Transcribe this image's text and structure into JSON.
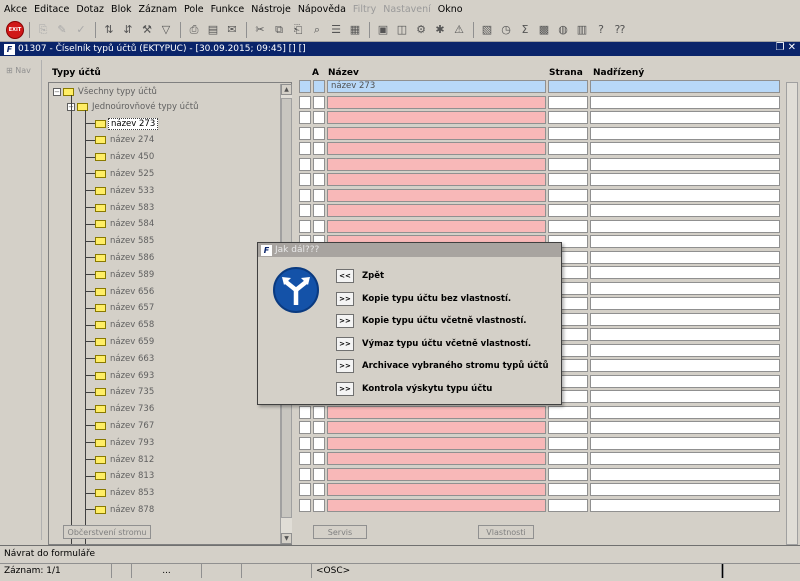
{
  "menu": [
    "Akce",
    "Editace",
    "Dotaz",
    "Blok",
    "Záznam",
    "Pole",
    "Funkce",
    "Nástroje",
    "Nápověda",
    "Filtry",
    "Nastavení",
    "Okno"
  ],
  "menu_disabled": [
    "Filtry",
    "Nastavení"
  ],
  "window": {
    "title": "01307 - Číselník typů účtů (EKTYPUC) - [30.09.2015; 09:45]  []  []",
    "controls": "❐ ✕"
  },
  "nav_label": "Nav",
  "tree": {
    "header": "Typy účtů",
    "root": "Všechny typy účtů",
    "child": "Jednoúrovňové typy účtů",
    "items": [
      "název 273",
      "název 274",
      "název 450",
      "název 525",
      "název 533",
      "název 583",
      "název 584",
      "název 585",
      "název 586",
      "název 589",
      "název 656",
      "název 657",
      "název 658",
      "název 659",
      "název 663",
      "název 693",
      "název 735",
      "název 736",
      "název 767",
      "název 793",
      "název 812",
      "název 813",
      "název 853",
      "název 878"
    ]
  },
  "grid": {
    "headers": {
      "a": "A",
      "nazev": "Název",
      "strana": "Strana",
      "nadrizeny": "Nadřízený"
    },
    "first_row_name": "název 273"
  },
  "buttons": {
    "refresh": "Občerstvení stromu",
    "servis": "Servis",
    "vlastnosti": "Vlastnosti"
  },
  "status": {
    "message": "Návrat do formuláře",
    "record": "Záznam: 1/1",
    "dots": "...",
    "mode": "<OSC>"
  },
  "dialog": {
    "title": "Jak dál???",
    "items": [
      {
        "btn": "<<",
        "label": "Zpět"
      },
      {
        "btn": ">>",
        "label": "Kopie typu účtu bez vlastností."
      },
      {
        "btn": ">>",
        "label": "Kopie typu účtu včetně vlastností."
      },
      {
        "btn": ">>",
        "label": "Výmaz typu účtu včetně vlastností."
      },
      {
        "btn": ">>",
        "label": "Archivace vybraného stromu typů účtů"
      },
      {
        "btn": ">>",
        "label": "Kontrola výskytu typu účtu"
      }
    ]
  },
  "colors": {
    "title_bar": "#0a246a",
    "pink_cell": "#f8b8b8",
    "selected_row": "#b8d8f8",
    "dialog_title": "#a8a4a0",
    "sign_blue": "#1452a8"
  }
}
